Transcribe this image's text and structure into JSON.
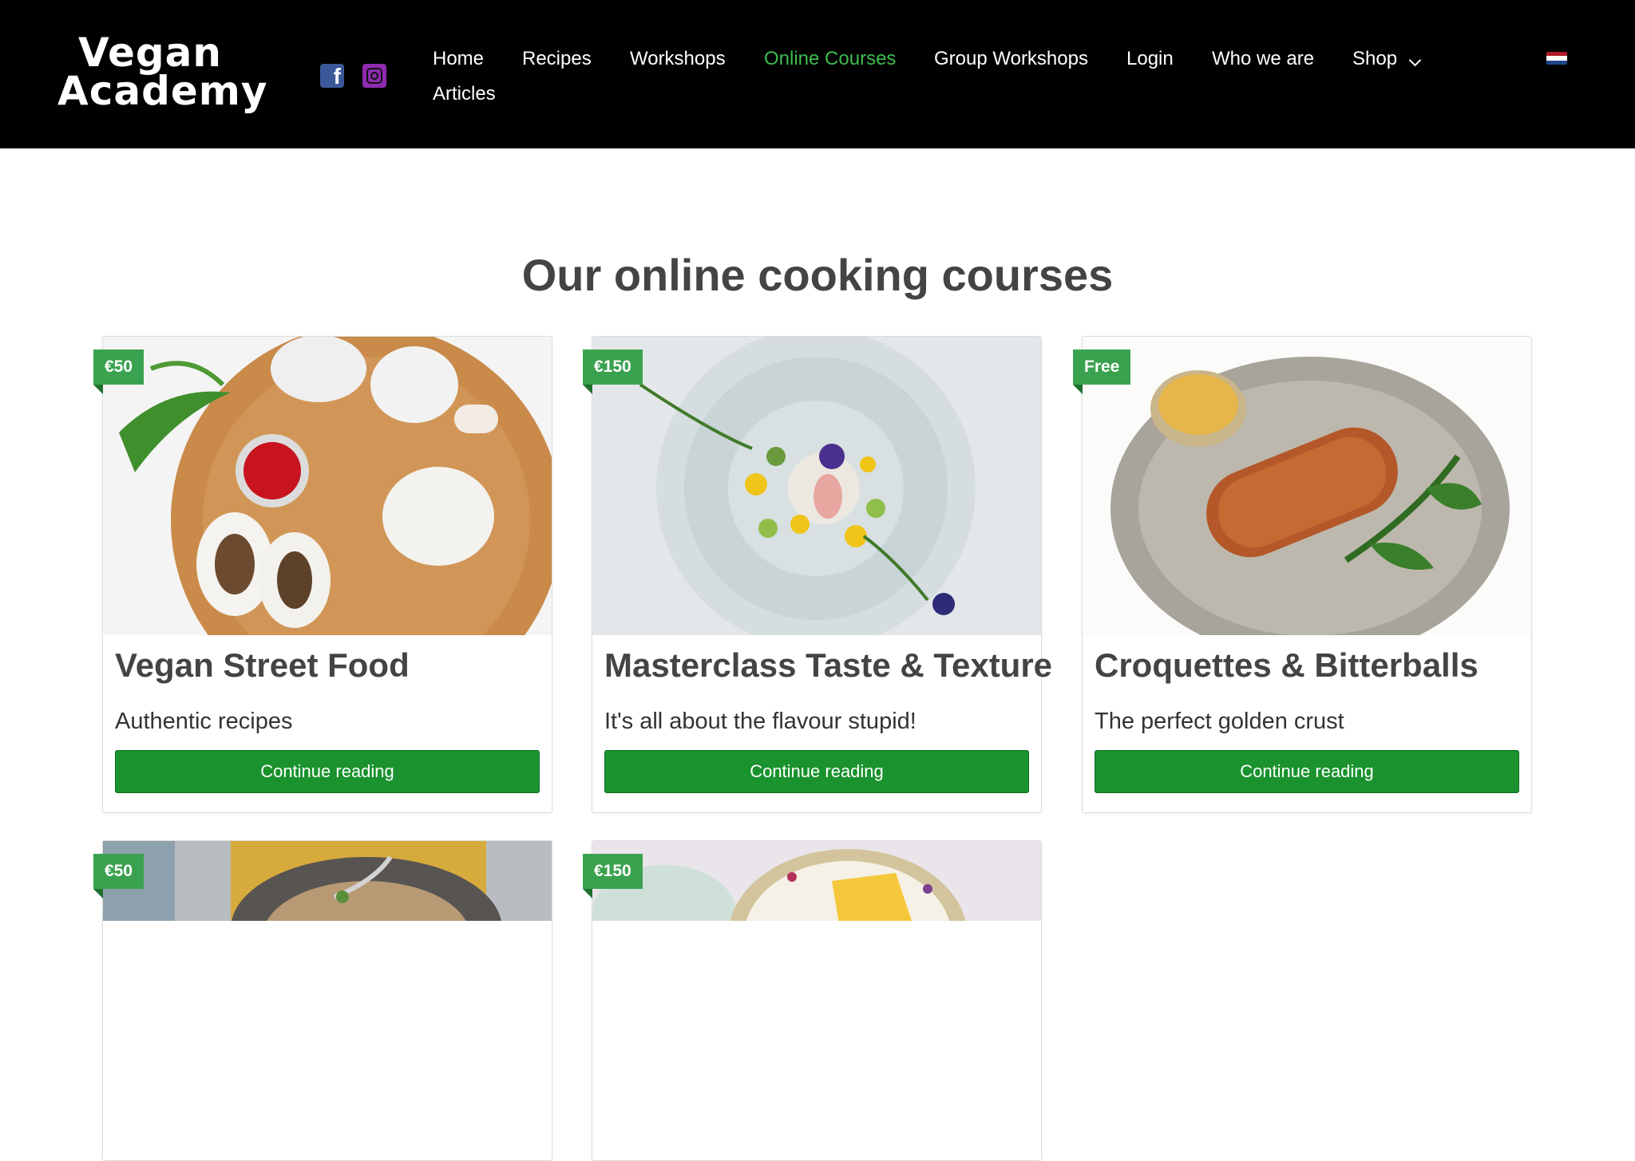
{
  "header": {
    "logo_line1": "Vegan",
    "logo_line2": "Academy",
    "nav": [
      {
        "label": "Home"
      },
      {
        "label": "Recipes"
      },
      {
        "label": "Workshops"
      },
      {
        "label": "Online Courses",
        "active": true
      },
      {
        "label": "Group Workshops"
      },
      {
        "label": "Login"
      },
      {
        "label": "Who we are"
      },
      {
        "label": "Shop"
      },
      {
        "label": "Articles"
      }
    ],
    "social": [
      "facebook-icon",
      "instagram-icon"
    ],
    "language_flag": "netherlands-flag-icon"
  },
  "main": {
    "title": "Our online cooking courses",
    "courses": [
      {
        "price": "€50",
        "title": "Vegan Street Food",
        "subtitle": "Authentic recipes",
        "button": "Continue reading"
      },
      {
        "price": "€150",
        "title": "Masterclass Taste & Texture",
        "subtitle": "It's all about the flavour stupid!",
        "button": "Continue reading"
      },
      {
        "price": "Free",
        "title": "Croquettes & Bitterballs",
        "subtitle": "The perfect golden crust",
        "button": "Continue reading"
      },
      {
        "price": "€50"
      },
      {
        "price": "€150"
      }
    ]
  },
  "colors": {
    "header_bg": "#000000",
    "accent_green": "#1a922e",
    "active_nav": "#3dbb4e",
    "badge_green": "#3aa24e"
  }
}
